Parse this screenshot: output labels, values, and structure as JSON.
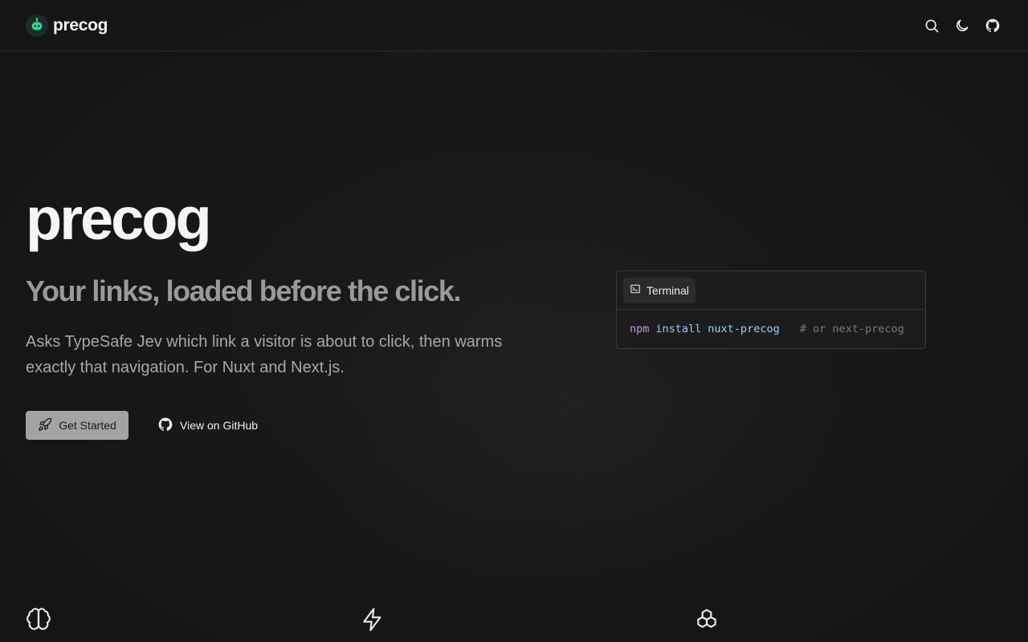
{
  "header": {
    "brand_name": "precog",
    "actions": [
      {
        "icon": "search-icon"
      },
      {
        "icon": "moon-icon"
      },
      {
        "icon": "github-icon"
      }
    ]
  },
  "hero": {
    "title": "precog",
    "tagline": "Your links, loaded before the click.",
    "description": "Asks TypeSafe Jev which link a visitor is about to click, then warms exactly that navigation. For Nuxt and Next.js.",
    "primary_button": "Get Started",
    "secondary_button": "View on GitHub"
  },
  "terminal": {
    "tab_label": "Terminal",
    "command": "npm",
    "subcommand": "install",
    "package": "nuxt-precog",
    "comment": "# or next-precog"
  },
  "features": [
    {
      "icon": "brain-icon"
    },
    {
      "icon": "zap-icon"
    },
    {
      "icon": "boxes-icon"
    }
  ],
  "colors": {
    "background": "#161616",
    "primary_button_bg": "#a3a3a3",
    "accent_logo": "#3ecf8e",
    "terminal_command": "#c792ea",
    "terminal_arg": "#9ecbff"
  }
}
